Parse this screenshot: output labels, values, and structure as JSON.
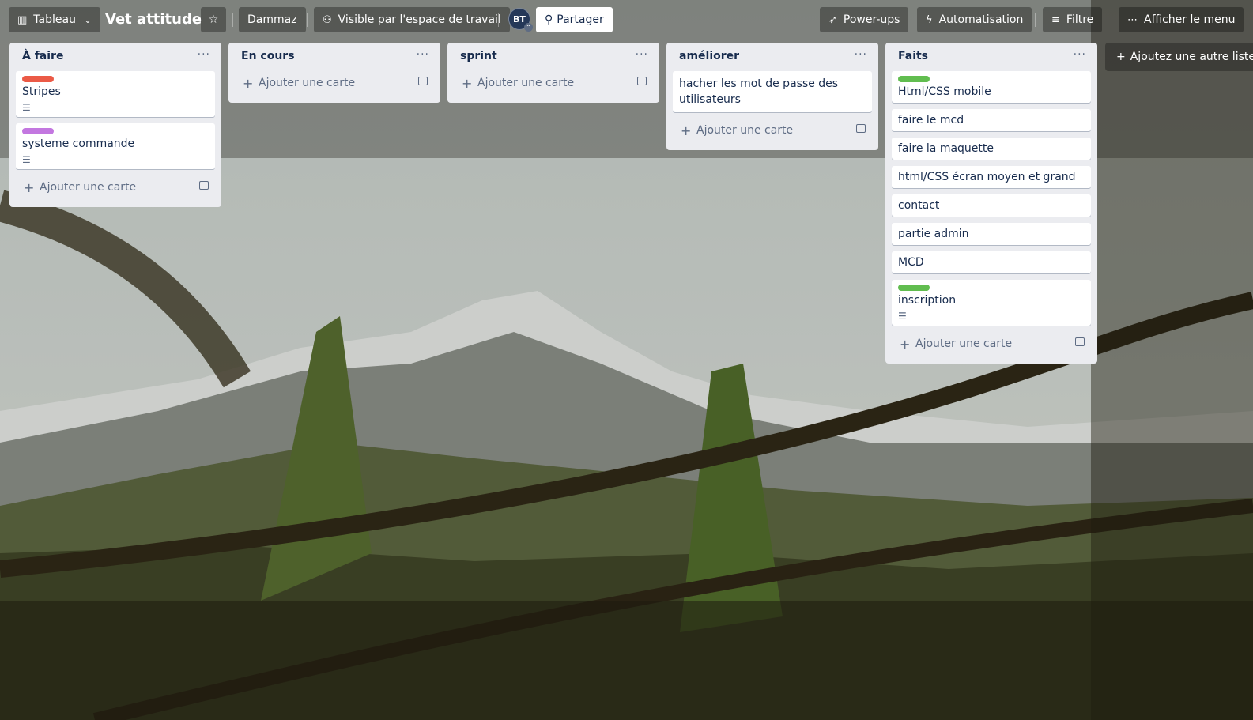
{
  "header": {
    "view_switcher_label": "Tableau",
    "board_title": "Vet attitude",
    "workspace_label": "Dammaz",
    "visibility_label": "Visible par l'espace de travail",
    "member_initials": "BT",
    "share_label": "Partager",
    "powerups_label": "Power-ups",
    "automation_label": "Automatisation",
    "filter_label": "Filtre",
    "menu_label": "Afficher le menu"
  },
  "lists": [
    {
      "title": "À faire",
      "cards": [
        {
          "title": "Stripes",
          "label_color": "#eb5a46",
          "has_description": true
        },
        {
          "title": "systeme commande",
          "label_color": "#c377e0",
          "has_description": true
        }
      ]
    },
    {
      "title": "En cours",
      "cards": []
    },
    {
      "title": "sprint",
      "cards": []
    },
    {
      "title": "améliorer",
      "cards": [
        {
          "title": "hacher les mot de passe des utilisateurs"
        }
      ]
    },
    {
      "title": "Faits",
      "cards": [
        {
          "title": "Html/CSS mobile",
          "label_color": "#61bd4f"
        },
        {
          "title": "faire le mcd"
        },
        {
          "title": "faire la maquette"
        },
        {
          "title": "html/CSS écran moyen et grand"
        },
        {
          "title": "contact"
        },
        {
          "title": "partie admin"
        },
        {
          "title": "MCD"
        },
        {
          "title": "inscription",
          "label_color": "#61bd4f",
          "has_description": true
        }
      ]
    }
  ],
  "add_card_label": "Ajouter une carte",
  "add_list_label": "Ajoutez une autre liste",
  "colors": {
    "list_background": "#ebecf0",
    "label_red": "#eb5a46",
    "label_purple": "#c377e0",
    "label_green": "#61bd4f"
  }
}
